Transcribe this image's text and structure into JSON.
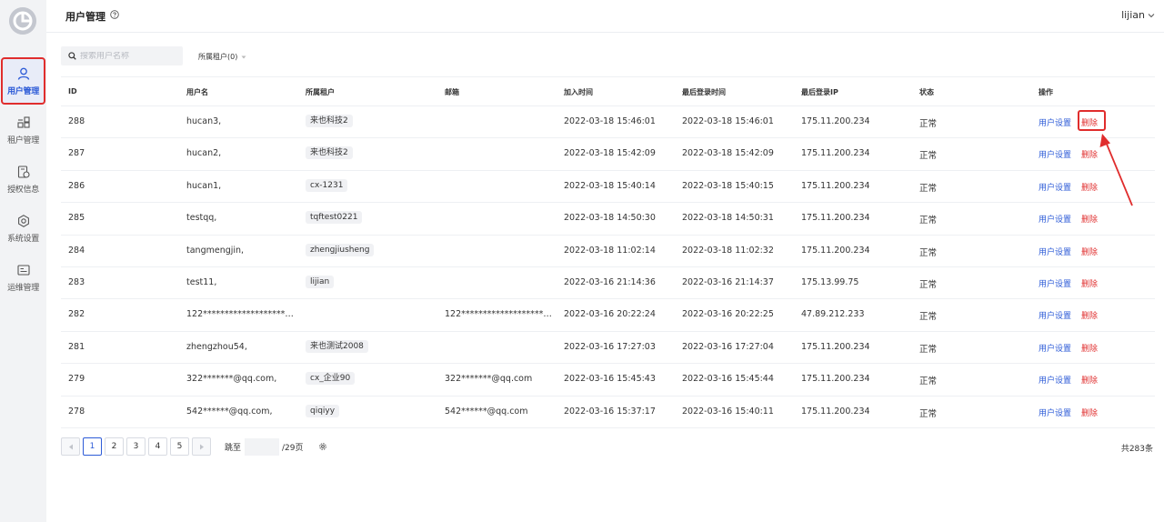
{
  "sidebar": {
    "items": [
      {
        "label": "用户管理",
        "icon": "user-icon",
        "active": true
      },
      {
        "label": "租户管理",
        "icon": "tenant-icon",
        "active": false
      },
      {
        "label": "授权信息",
        "icon": "license-icon",
        "active": false
      },
      {
        "label": "系统设置",
        "icon": "gear-icon",
        "active": false
      },
      {
        "label": "运维管理",
        "icon": "ops-icon",
        "active": false
      }
    ]
  },
  "header": {
    "title": "用户管理",
    "user": "lijian"
  },
  "toolbar": {
    "search_placeholder": "搜索用户名称",
    "tenant_filter": "所属租户(0)"
  },
  "table": {
    "columns": [
      "ID",
      "用户名",
      "所属租户",
      "邮箱",
      "加入时间",
      "最后登录时间",
      "最后登录IP",
      "状态",
      "操作"
    ],
    "rows": [
      {
        "id": "288",
        "username": "hucan3,",
        "tenant": "来也科技2",
        "email": "",
        "joined": "2022-03-18 15:46:01",
        "last_login": "2022-03-18 15:46:01",
        "ip": "175.11.200.234",
        "status": "正常"
      },
      {
        "id": "287",
        "username": "hucan2,",
        "tenant": "来也科技2",
        "email": "",
        "joined": "2022-03-18 15:42:09",
        "last_login": "2022-03-18 15:42:09",
        "ip": "175.11.200.234",
        "status": "正常"
      },
      {
        "id": "286",
        "username": "hucan1,",
        "tenant": "cx-1231",
        "email": "",
        "joined": "2022-03-18 15:40:14",
        "last_login": "2022-03-18 15:40:15",
        "ip": "175.11.200.234",
        "status": "正常"
      },
      {
        "id": "285",
        "username": "testqq,",
        "tenant": "tqftest0221",
        "email": "",
        "joined": "2022-03-18 14:50:30",
        "last_login": "2022-03-18 14:50:31",
        "ip": "175.11.200.234",
        "status": "正常"
      },
      {
        "id": "284",
        "username": "tangmengjin,",
        "tenant": "zhengjiusheng",
        "email": "",
        "joined": "2022-03-18 11:02:14",
        "last_login": "2022-03-18 11:02:32",
        "ip": "175.11.200.234",
        "status": "正常"
      },
      {
        "id": "283",
        "username": "test11,",
        "tenant": "lijian",
        "email": "",
        "joined": "2022-03-16 21:14:36",
        "last_login": "2022-03-16 21:14:37",
        "ip": "175.13.99.75",
        "status": "正常"
      },
      {
        "id": "282",
        "username": "122*********************...",
        "tenant": "",
        "email": "122*********************...",
        "joined": "2022-03-16 20:22:24",
        "last_login": "2022-03-16 20:22:25",
        "ip": "47.89.212.233",
        "status": "正常"
      },
      {
        "id": "281",
        "username": "zhengzhou54,",
        "tenant": "来也测试2008",
        "email": "",
        "joined": "2022-03-16 17:27:03",
        "last_login": "2022-03-16 17:27:04",
        "ip": "175.11.200.234",
        "status": "正常"
      },
      {
        "id": "279",
        "username": "322*******@qq.com,",
        "tenant": "cx_企业90",
        "email": "322*******@qq.com",
        "joined": "2022-03-16 15:45:43",
        "last_login": "2022-03-16 15:45:44",
        "ip": "175.11.200.234",
        "status": "正常"
      },
      {
        "id": "278",
        "username": "542******@qq.com,",
        "tenant": "qiqiyy",
        "email": "542******@qq.com",
        "joined": "2022-03-16 15:37:17",
        "last_login": "2022-03-16 15:40:11",
        "ip": "175.11.200.234",
        "status": "正常"
      }
    ],
    "actions": {
      "settings": "用户设置",
      "delete": "删除"
    }
  },
  "pagination": {
    "pages": [
      "1",
      "2",
      "3",
      "4",
      "5"
    ],
    "current": "1",
    "jump_label": "跳至",
    "jump_total": "/29页",
    "total": "共283条"
  },
  "colors": {
    "accent": "#2d5bd7",
    "danger": "#e03030",
    "highlight": "#e02d2d"
  }
}
